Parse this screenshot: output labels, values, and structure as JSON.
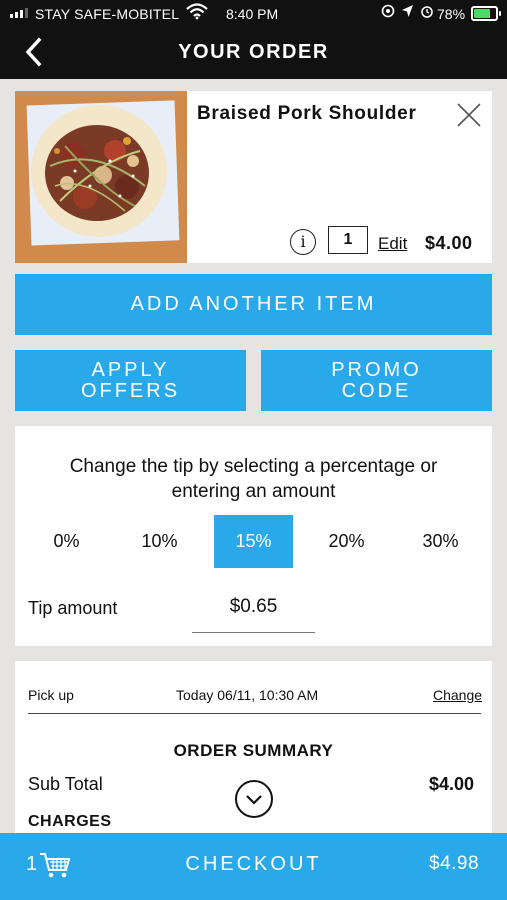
{
  "status_bar": {
    "carrier": "STAY SAFE-MOBITEL",
    "time": "8:40 PM",
    "battery": "78%"
  },
  "header": {
    "title": "YOUR ORDER"
  },
  "item": {
    "name": "Braised Pork Shoulder",
    "quantity": "1",
    "edit_label": "Edit",
    "price": "$4.00",
    "info_glyph": "i"
  },
  "buttons": {
    "add_another": "ADD ANOTHER ITEM",
    "apply_offers_line1": "APPLY",
    "apply_offers_line2": "OFFERS",
    "promo_line1": "PROMO",
    "promo_line2": "CODE"
  },
  "tip": {
    "prompt": "Change the tip by selecting a percentage or entering an amount",
    "options": [
      "0%",
      "10%",
      "15%",
      "20%",
      "30%"
    ],
    "selected": "15%",
    "amount_label": "Tip amount",
    "amount": "$0.65"
  },
  "summary": {
    "pickup_label": "Pick up",
    "pickup_time": "Today 06/11, 10:30 AM",
    "change_label": "Change",
    "title": "ORDER SUMMARY",
    "subtotal_label": "Sub Total",
    "subtotal_value": "$4.00",
    "charges_label": "CHARGES"
  },
  "checkout": {
    "cart_count": "1",
    "label": "CHECKOUT",
    "total": "$4.98"
  },
  "colors": {
    "accent": "#29a9e9",
    "header": "#111111",
    "background": "#e6e3e3"
  }
}
